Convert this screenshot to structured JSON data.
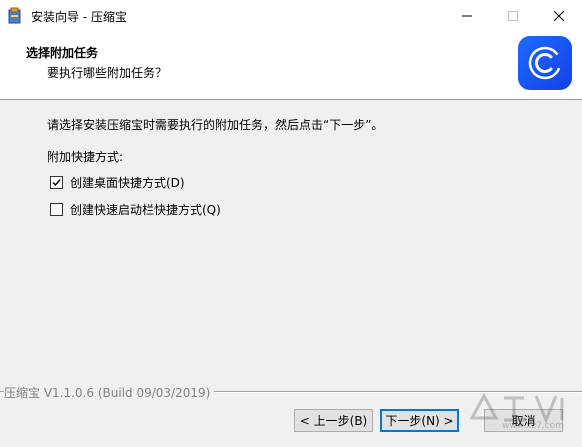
{
  "window": {
    "title": "安装向导 - 压缩宝"
  },
  "header": {
    "title": "选择附加任务",
    "subtitle": "要执行哪些附加任务？"
  },
  "main": {
    "instruction": "请选择安装压缩宝时需要执行的附加任务，然后点击“下一步”。",
    "group_label": "附加快捷方式:",
    "options": [
      {
        "label": "创建桌面快捷方式(D)",
        "checked": true
      },
      {
        "label": "创建快速启动栏快捷方式(Q)",
        "checked": false
      }
    ]
  },
  "footer": {
    "version": "压缩宝 V1.1.0.6 (Build 09/03/2019)",
    "back_label": "< 上一步(B)",
    "next_label": "下一步(N) >",
    "cancel_label": "取消"
  },
  "watermark": {
    "site": "www.xz7.com"
  },
  "colors": {
    "accent": "#0078d7",
    "logo": "#1e5cff"
  },
  "icons": {
    "app": "installer-icon",
    "logo": "compress-logo-icon",
    "minimize": "minimize-icon",
    "maximize": "maximize-icon",
    "close": "close-icon"
  }
}
